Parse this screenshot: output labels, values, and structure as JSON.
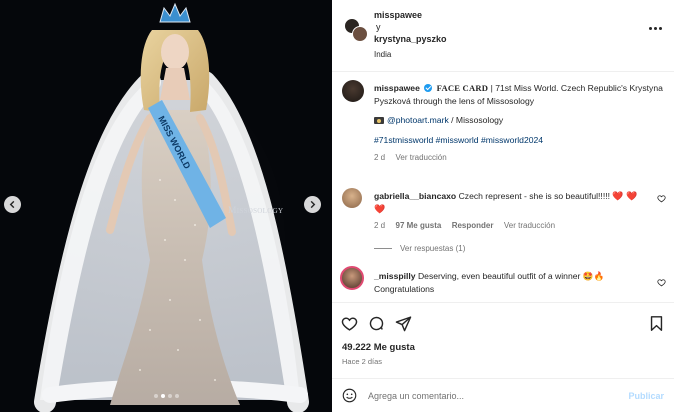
{
  "media": {
    "watermark": "Missosology",
    "carousel_dots": 4,
    "active_dot": 1,
    "sash_text": "MISS WORLD"
  },
  "header": {
    "username_1": "misspawee",
    "connector": "y",
    "username_2": "krystyna_pyszko",
    "location": "India"
  },
  "caption": {
    "username": "misspawee",
    "title": "FACE CARD",
    "text": " | 71st Miss World. Czech Republic's Krystyna Pyszková through the lens of Missosology",
    "credit_link": "@photoart.mark",
    "credit_rest": " / Missosology",
    "hashtags": "#71stmissworld #missworld #missworld2024",
    "time": "2 d",
    "translate": "Ver traducción"
  },
  "comments": [
    {
      "username": "gabriella__biancaxo",
      "text": "Czech represent - she is so beautiful!!!!! ",
      "hearts": "❤️ ❤️ ❤️",
      "time": "2 d",
      "likes": "97 Me gusta",
      "reply": "Responder",
      "translate": "Ver traducción",
      "view_replies": "Ver respuestas (1)"
    },
    {
      "username": "_misspilly",
      "text": "Deserving, even beautiful outfit of a winner 🤩🔥 Congratulations"
    }
  ],
  "stats": {
    "likes": "49.222 Me gusta",
    "posted": "Hace 2 días"
  },
  "composer": {
    "placeholder": "Agrega un comentario...",
    "post_label": "Publicar"
  },
  "colors": {
    "verified": "#1d9bf0",
    "link": "#00376b",
    "post_disabled": "#b3dbff",
    "sash": "#6fb3e6"
  }
}
